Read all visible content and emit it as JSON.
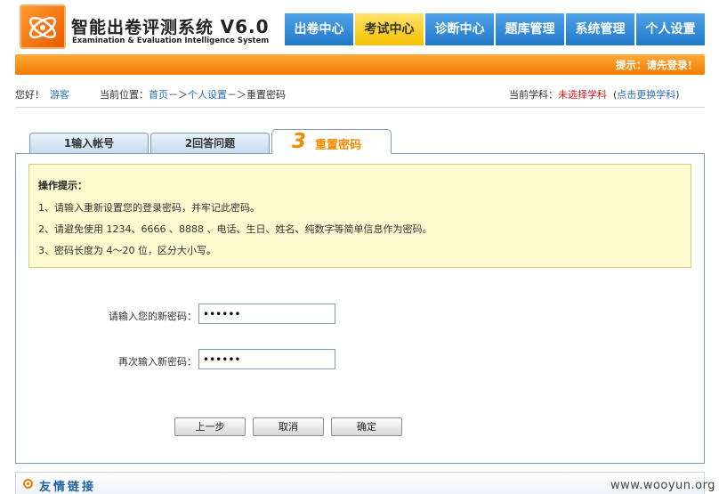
{
  "header": {
    "brand_cn": "智能出卷评测系统",
    "brand_version": "V6.0",
    "brand_en": "Examination & Evaluation Intelligence System"
  },
  "nav": [
    {
      "label": "出卷中心",
      "active": false
    },
    {
      "label": "考试中心",
      "active": true
    },
    {
      "label": "诊断中心",
      "active": false
    },
    {
      "label": "题库管理",
      "active": false
    },
    {
      "label": "系统管理",
      "active": false
    },
    {
      "label": "个人设置",
      "active": false
    }
  ],
  "orange_bar": {
    "tip": "提示：请先登录！"
  },
  "info": {
    "greeting": "您好！",
    "user": "游客",
    "location_label": "当前位置：",
    "crumb_home": "首页",
    "crumb_sep": "－＞",
    "crumb_settings": "个人设置",
    "crumb_current": "重置密码",
    "subject_label": "当前学科：",
    "subject_value": "未选择学科",
    "change_subject": "点击更换学科"
  },
  "steps": [
    {
      "label": "1输入帐号"
    },
    {
      "label": "2回答问题"
    },
    {
      "num": "3",
      "label": "重置密码"
    }
  ],
  "tips": {
    "title": "操作提示：",
    "lines": [
      "1、请输入重新设置您的登录密码，并牢记此密码。",
      "2、请避免使用 1234、6666 、8888 、电话、生日、姓名、纯数字等简单信息作为密码。",
      "3、密码长度为 4～20 位，区分大小写。"
    ]
  },
  "form": {
    "new_password_label": "请输入您的新密码：",
    "new_password_value": "••••••",
    "confirm_password_label": "再次输入新密码：",
    "confirm_password_value": "••••••"
  },
  "buttons": {
    "prev": "上一步",
    "cancel": "取消",
    "confirm": "确定"
  },
  "friend_links": {
    "title": "友情链接"
  },
  "watermark": "www.wooyun.org",
  "colors": {
    "nav_blue": "#1f78c8",
    "nav_active": "#f5c000",
    "orange": "#f07c00",
    "tips_bg": "#fffbd1",
    "link": "#2a6ebb",
    "red": "#d4121b"
  }
}
